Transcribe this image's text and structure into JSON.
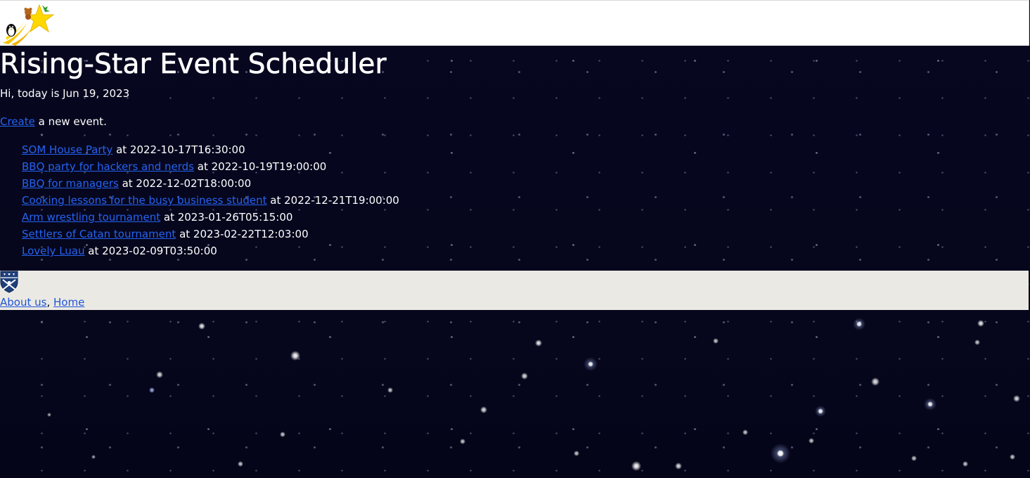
{
  "header": {
    "logo_icon": "rising-star-logo-icon"
  },
  "main": {
    "title": "Rising-Star Event Scheduler",
    "greeting": "Hi, today is Jun 19, 2023",
    "create_link": "Create",
    "create_suffix": " a new event.",
    "events": [
      {
        "name": "SOM House Party",
        "at": " at 2022-10-17T16:30:00"
      },
      {
        "name": "BBQ party for hackers and nerds",
        "at": " at 2022-10-19T19:00:00"
      },
      {
        "name": "BBQ for managers",
        "at": " at 2022-12-02T18:00:00"
      },
      {
        "name": "Cooking lessons for the busy business student",
        "at": " at 2022-12-21T19:00:00"
      },
      {
        "name": "Arm wrestling tournament",
        "at": " at 2023-01-26T05:15:00"
      },
      {
        "name": "Settlers of Catan tournament",
        "at": " at 2023-02-22T12:03:00"
      },
      {
        "name": "Lovely Luau",
        "at": " at 2023-02-09T03:50:00"
      }
    ]
  },
  "footer": {
    "crest_icon": "university-shield-icon",
    "about_link": "About us",
    "separator": ", ",
    "home_link": "Home"
  },
  "colors": {
    "link": "#2563f0",
    "footer_bg": "#ebe9e4",
    "night_sky": "#06061a"
  }
}
